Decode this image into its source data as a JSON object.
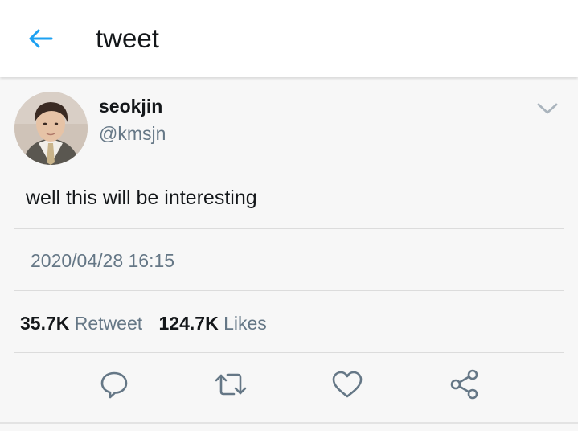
{
  "header": {
    "title": "tweet",
    "back_icon": "arrow-left-icon"
  },
  "tweet": {
    "display_name": "seokjin",
    "handle": "@kmsjn",
    "text": "well this will be interesting",
    "timestamp": "2020/04/28 16:15",
    "retweet_count": "35.7K",
    "retweet_label": "Retweet",
    "like_count": "124.7K",
    "like_label": "Likes"
  },
  "actions": [
    "reply-icon",
    "retweet-icon",
    "like-icon",
    "share-icon"
  ],
  "colors": {
    "accent": "#1da1f2",
    "icon": "#657786",
    "text": "#14171a",
    "muted": "#657786"
  }
}
